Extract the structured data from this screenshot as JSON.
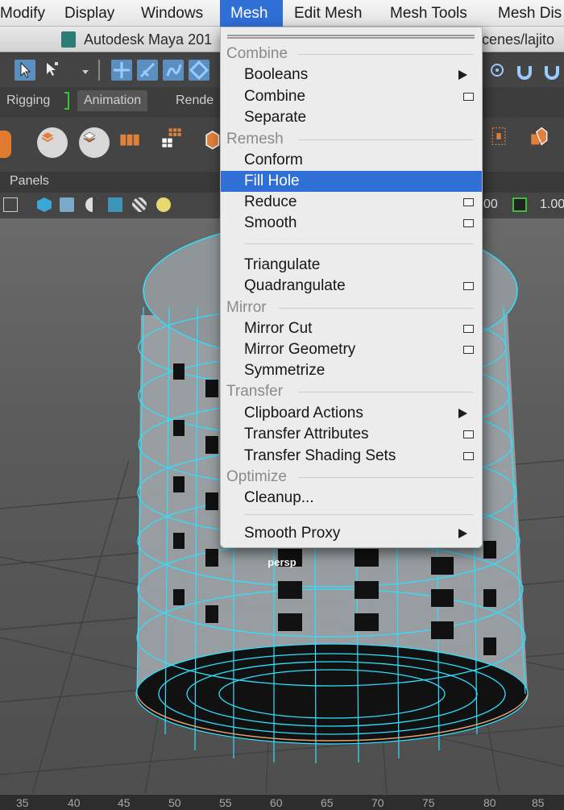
{
  "menubar": {
    "items": [
      {
        "label": "Modify"
      },
      {
        "label": "Display"
      },
      {
        "label": "Windows"
      },
      {
        "label": "Mesh"
      },
      {
        "label": "Edit Mesh"
      },
      {
        "label": "Mesh Tools"
      },
      {
        "label": "Mesh Dis"
      }
    ],
    "active_color": "#2f6fd6"
  },
  "titlebar": {
    "title_left": "Autodesk Maya 201",
    "title_right": "cenes/lajito"
  },
  "shelf": {
    "tabs": [
      {
        "label": "Rigging"
      },
      {
        "label": "Animation"
      },
      {
        "label": "Rende"
      }
    ]
  },
  "panels": {
    "label": "Panels",
    "field_left": "00",
    "field_right": "1.00"
  },
  "viewport": {
    "camera": "persp"
  },
  "timeline": {
    "ticks": [
      "35",
      "40",
      "45",
      "50",
      "55",
      "60",
      "65",
      "70",
      "75",
      "80",
      "85"
    ]
  },
  "mesh_menu": {
    "sections": {
      "combine": "Combine",
      "remesh": "Remesh",
      "mirror": "Mirror",
      "transfer": "Transfer",
      "optimize": "Optimize"
    },
    "items": {
      "booleans": "Booleans",
      "combine": "Combine",
      "separate": "Separate",
      "conform": "Conform",
      "fill_hole": "Fill Hole",
      "reduce": "Reduce",
      "smooth": "Smooth",
      "triangulate": "Triangulate",
      "quadrangulate": "Quadrangulate",
      "mirror_cut": "Mirror Cut",
      "mirror_geometry": "Mirror Geometry",
      "symmetrize": "Symmetrize",
      "clipboard_actions": "Clipboard Actions",
      "transfer_attributes": "Transfer Attributes",
      "transfer_shading_sets": "Transfer Shading Sets",
      "cleanup": "Cleanup...",
      "smooth_proxy": "Smooth Proxy"
    },
    "highlighted": "Fill Hole"
  }
}
